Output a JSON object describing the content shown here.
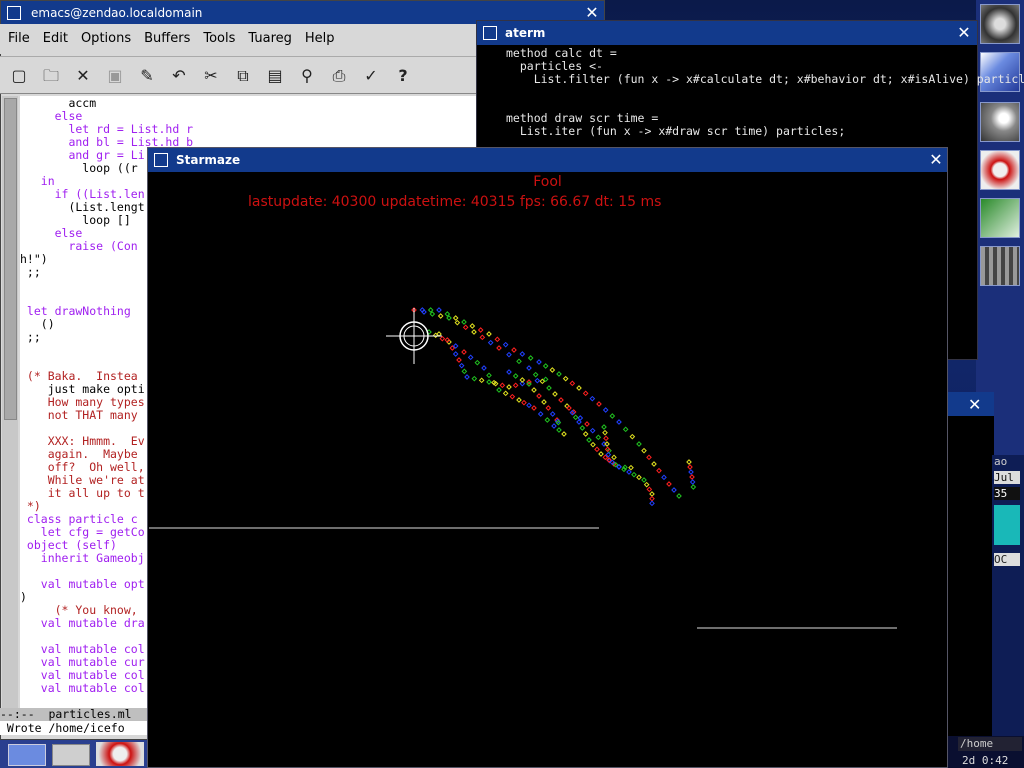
{
  "emacs": {
    "title": "emacs@zendao.localdomain",
    "menu": [
      "File",
      "Edit",
      "Options",
      "Buffers",
      "Tools",
      "Tuareg",
      "Help"
    ],
    "toolbar_icons": [
      "new-file-icon",
      "open-folder-icon",
      "close-icon",
      "save-disk-icon",
      "save-as-icon",
      "undo-icon",
      "cut-icon",
      "copy-icon",
      "paste-icon",
      "search-icon",
      "print-icon",
      "preferences-icon",
      "help-icon"
    ],
    "code_lines": [
      "       accm",
      "     else",
      "       let rd = List.hd r",
      "       and bl = List.hd b",
      "       and gr = Li",
      "         loop ((r",
      "   in",
      "     if ((List.len",
      "       (List.lengt",
      "         loop [] ",
      "     else",
      "       raise (Con",
      "h!\")",
      " ;;",
      "",
      "",
      " let drawNothing ",
      "   ()",
      " ;;",
      "",
      "",
      " (* Baka.  Instea",
      "    just make opti",
      "    How many types",
      "    not THAT many",
      "",
      "    XXX: Hmmm.  Ev",
      "    again.  Maybe",
      "    off?  Oh well,",
      "    While we're at",
      "    it all up to t",
      " *)",
      " class particle c",
      "   let cfg = getCo",
      " object (self)",
      "   inherit Gameobj",
      "",
      "   val mutable opt",
      ")",
      "     (* You know, ",
      "   val mutable dra",
      "",
      "   val mutable col",
      "   val mutable cur",
      "   val mutable col",
      "   val mutable col"
    ],
    "modeline": "--:--  particles.ml",
    "minibuffer": " Wrote /home/icefo"
  },
  "aterm": {
    "title": "aterm",
    "lines": [
      "method calc dt =",
      "  particles <-",
      "    List.filter (fun x -> x#calculate dt; x#behavior dt; x#isAlive) particles",
      "",
      "",
      "method draw scr time =",
      "  List.iter (fun x -> x#draw scr time) particles;"
    ]
  },
  "starmaze": {
    "title": "Starmaze",
    "status_line1": "Fool",
    "status_line2": "lastupdate: 40300 updatetime: 40315 fps: 66.67 dt: 15 ms",
    "text_color": "#cc1111"
  },
  "dock": {
    "icons": [
      "gnome-foot-icon",
      "monitor-icon",
      "gimp-icon",
      "opera-icon",
      "vim-icon",
      "mixer-icon"
    ]
  },
  "right_window": {
    "fragments": [
      "ao",
      "Jul",
      "35",
      "OC",
      "/home"
    ]
  },
  "clock": {
    "text": "2d 0:42"
  },
  "colors": {
    "titlebar": "#123a8c",
    "emacs_bg": "#d8d8d8",
    "terminal_bg": "#000000"
  }
}
